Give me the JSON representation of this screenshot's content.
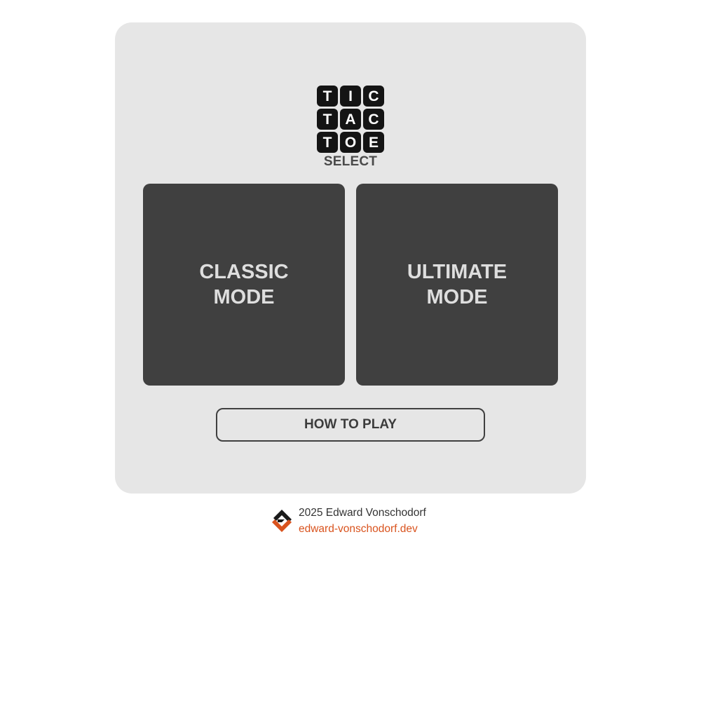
{
  "logo": {
    "tiles": [
      "T",
      "I",
      "C",
      "T",
      "A",
      "C",
      "T",
      "O",
      "E"
    ]
  },
  "header": {
    "select_label": "SELECT"
  },
  "modes": {
    "classic_label": "CLASSIC\nMODE",
    "ultimate_label": "ULTIMATE\nMODE"
  },
  "how_to_play": {
    "label": "HOW TO PLAY"
  },
  "footer": {
    "copyright": "2025 Edward Vonschodorf",
    "link_text": "edward-vonschodorf.dev",
    "logo_icon": "ev-brand-logo-icon"
  },
  "colors": {
    "card_background": "#e6e6e6",
    "mode_button": "#404040",
    "tile": "#141414",
    "accent": "#d9531e"
  }
}
